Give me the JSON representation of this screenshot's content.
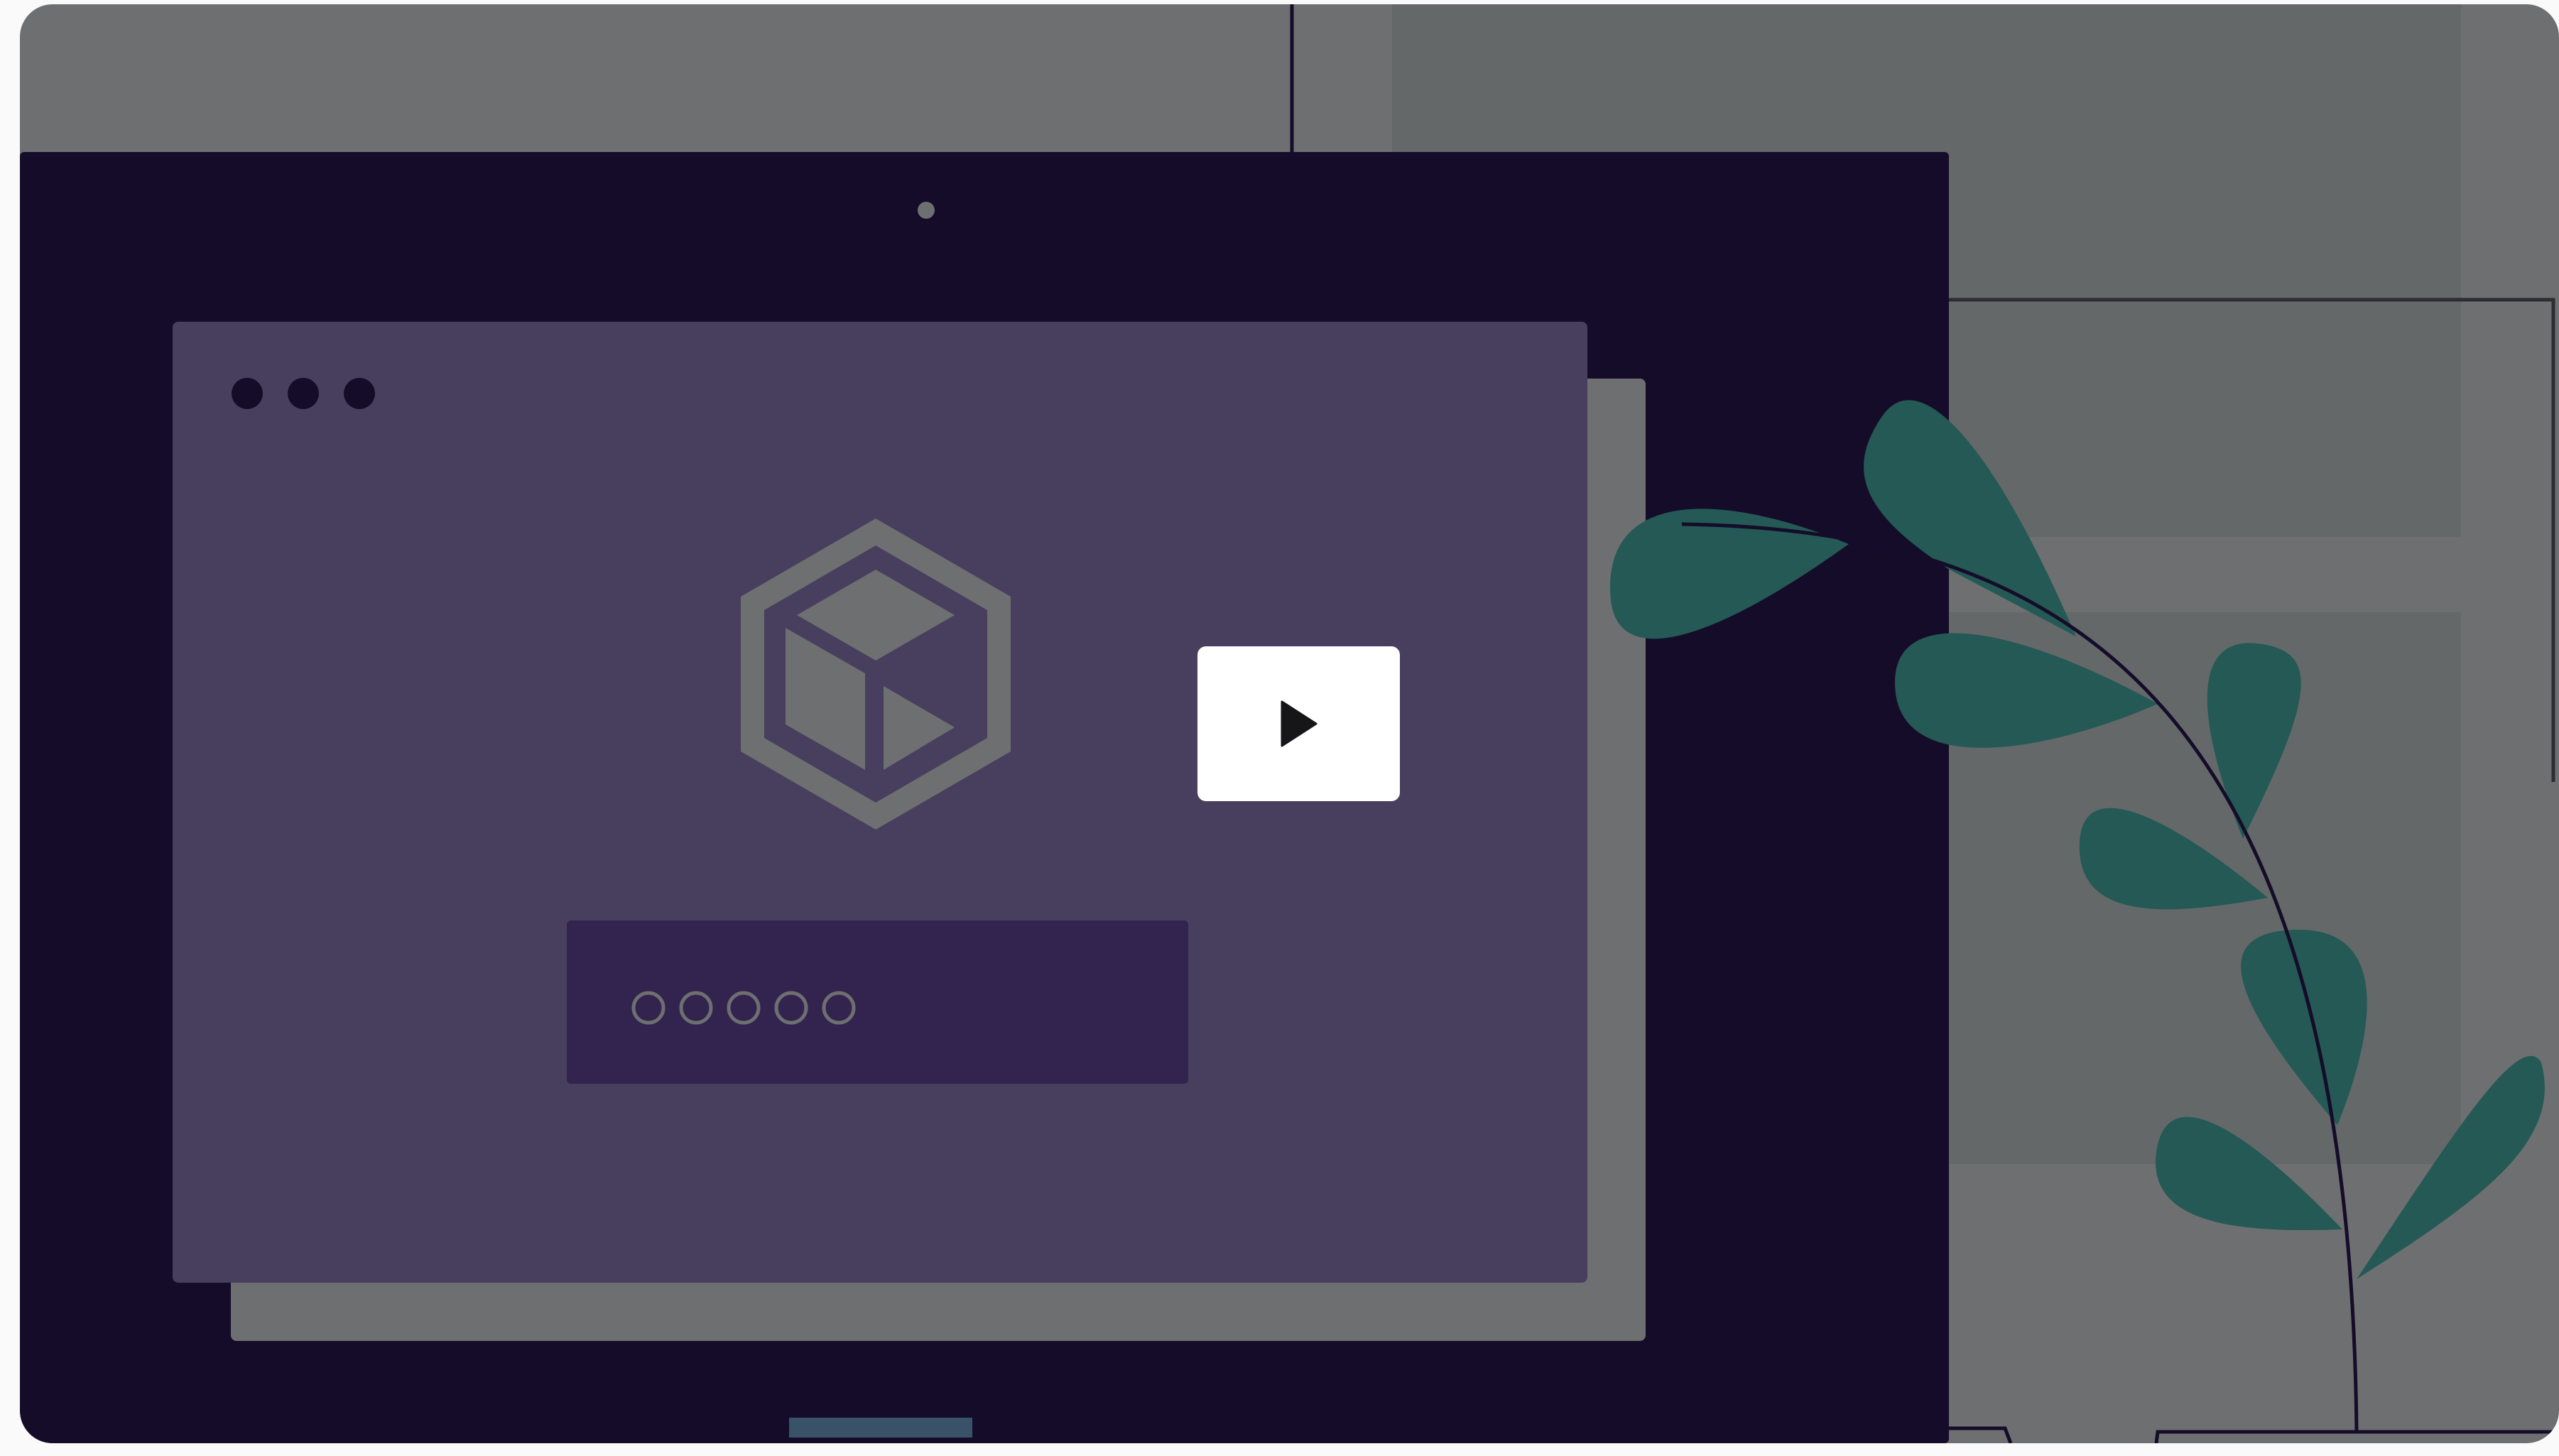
{
  "video_thumbnail": {
    "play_button": {
      "icon": "play-icon"
    },
    "window_controls": {
      "icons": [
        "window-dot-icon",
        "window-dot-icon",
        "window-dot-icon"
      ]
    },
    "product_logo": {
      "icon": "hexagon-cube-icon"
    },
    "password_field": {
      "masked_char_count": 5,
      "icon": "password-dot-icon"
    }
  },
  "colors": {
    "wall": "#6e6f70",
    "window_pane": "#646869",
    "monitor_bezel": "#150c2a",
    "screen_back_panel": "#6e6f70",
    "screen_window": "#483f5e",
    "window_dots": "#150c2a",
    "password_field": "#32244f",
    "leaf": "#245955",
    "stem": "#150c2a",
    "play_button": "#ffffff",
    "play_icon": "#161618",
    "stand_accent": "#3a5268"
  }
}
